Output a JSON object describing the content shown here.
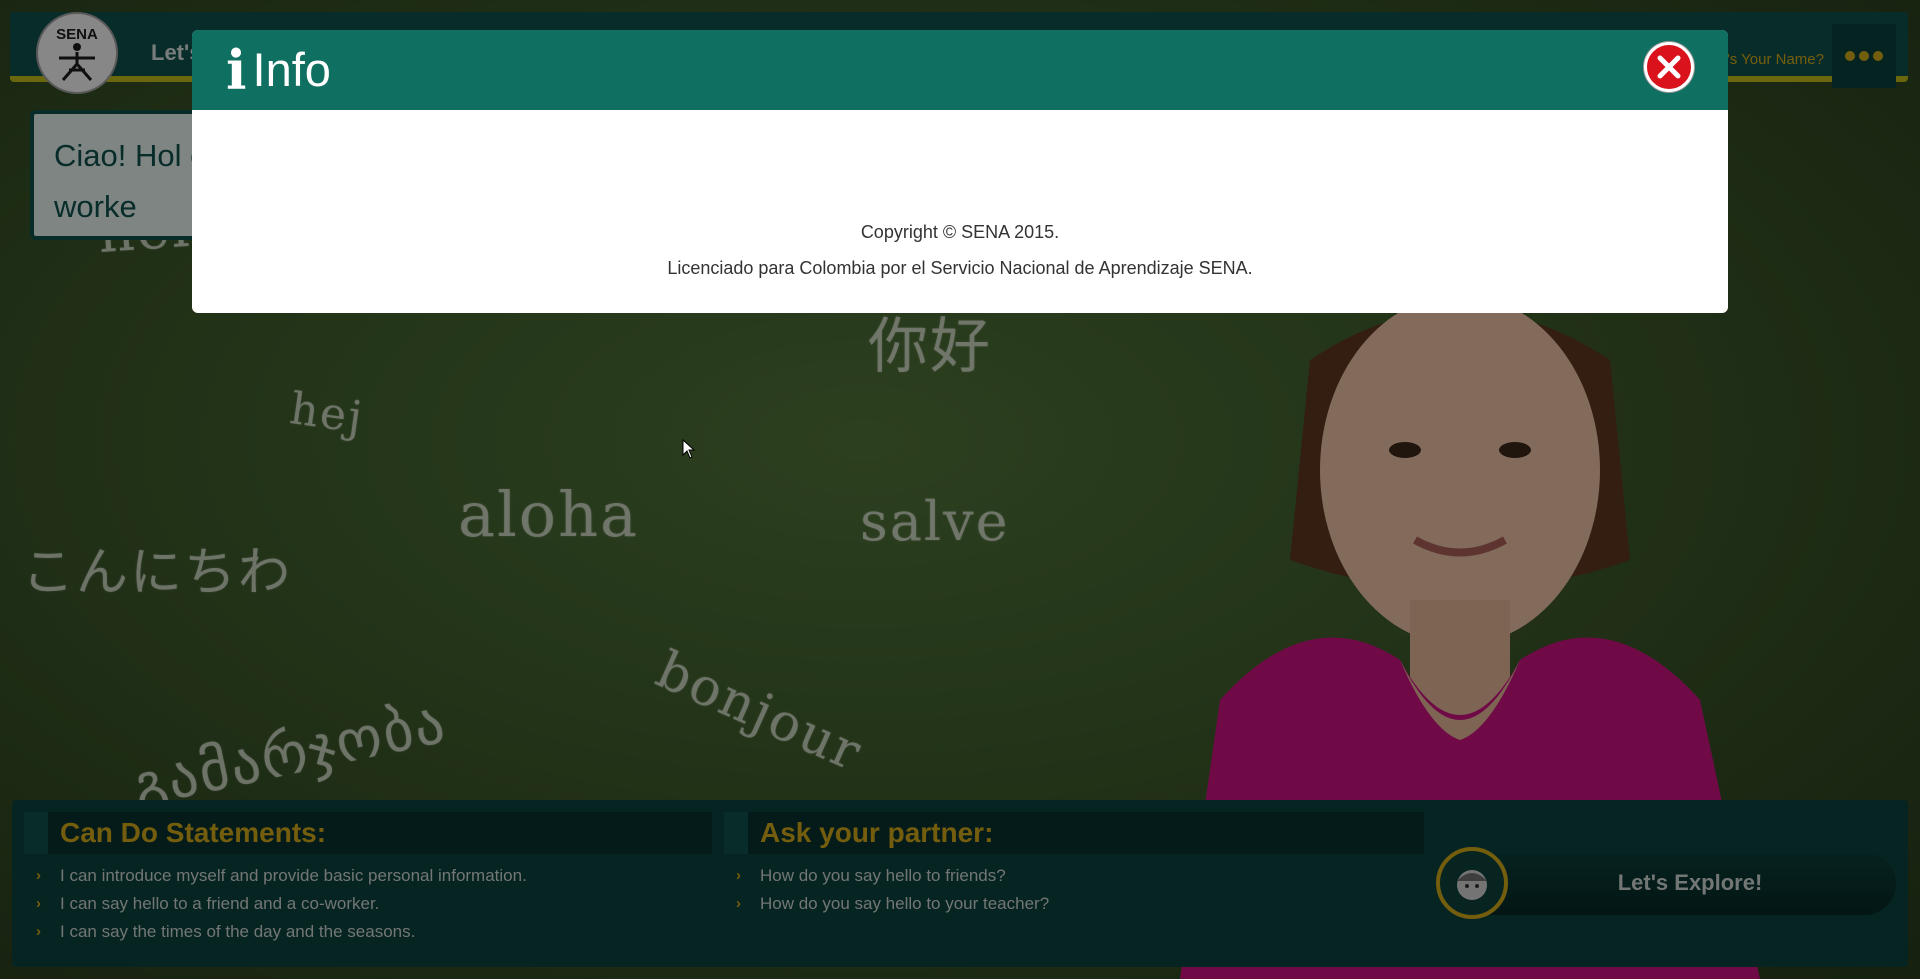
{
  "background": {
    "chalk_words": [
      "hej",
      "aloha",
      "salve",
      "こんにちわ",
      "bonjour",
      "你好",
      "გამარჯობა",
      "hello"
    ]
  },
  "topbar": {
    "logo_text": "SENA",
    "title": "Let's",
    "nav_link": "t's Your Name?"
  },
  "greeting": {
    "text": "Ciao! Hol co-worke"
  },
  "modal": {
    "title": "Info",
    "copyright": "Copyright © SENA 2015.",
    "license": "Licenciado para Colombia por el Servicio Nacional de Aprendizaje SENA."
  },
  "can_do": {
    "title": "Can Do Statements:",
    "items": [
      "I can introduce myself and provide basic personal information.",
      "I can say hello to a friend and a co-worker.",
      "I can say the times of the day and the seasons."
    ]
  },
  "ask_partner": {
    "title": "Ask your partner:",
    "items": [
      "How do you say hello to friends?",
      "How do you say hello to your teacher?"
    ]
  },
  "explore": {
    "label": "Let's Explore!"
  },
  "colors": {
    "teal_dark": "#0f4d47",
    "teal_header": "#0f6f61",
    "gold": "#c9a219",
    "close_red": "#d9121c"
  }
}
